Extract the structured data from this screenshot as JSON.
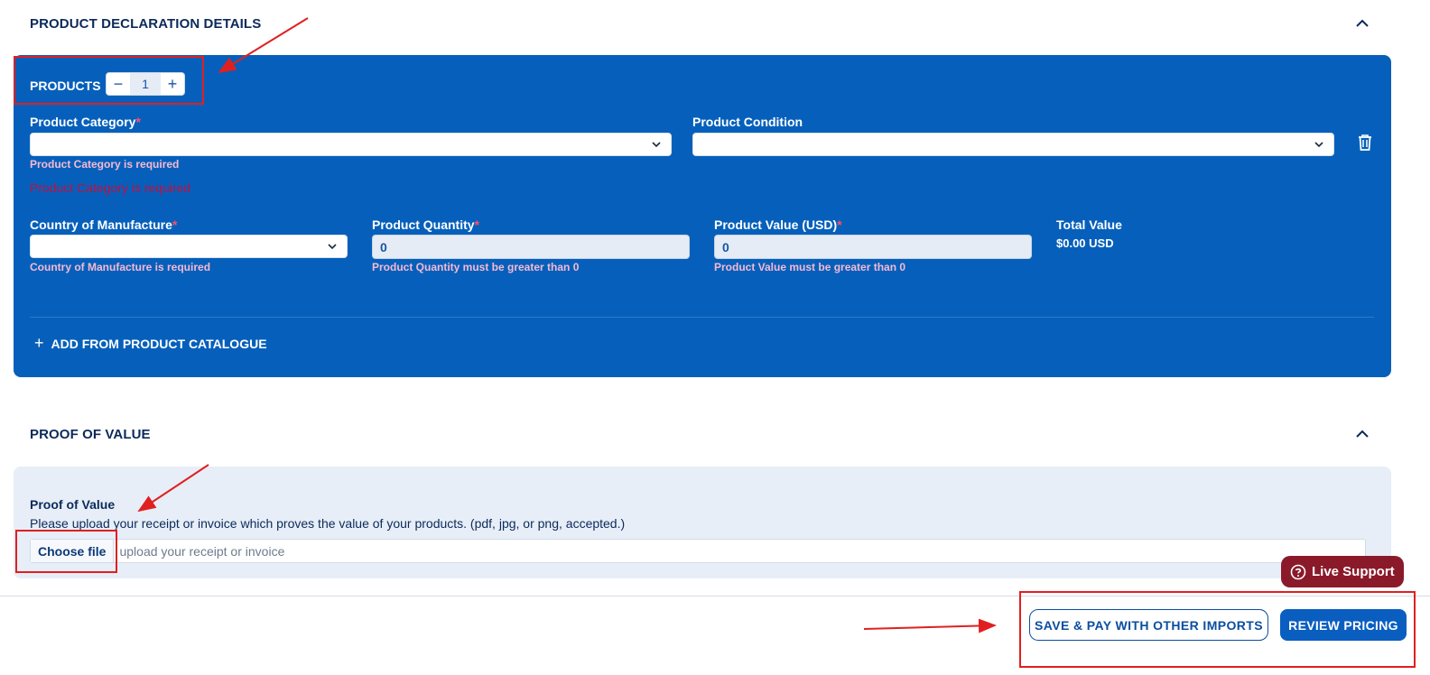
{
  "sections": {
    "product_declaration": {
      "title": "PRODUCT DECLARATION DETAILS"
    },
    "proof_of_value": {
      "title": "PROOF OF VALUE"
    }
  },
  "products": {
    "label": "PRODUCTS",
    "count": "1",
    "minus_symbol": "−",
    "plus_symbol": "+"
  },
  "fields": {
    "product_category": {
      "label": "Product Category",
      "required_mark": "*",
      "value": "",
      "error": "Product Category is required"
    },
    "product_condition": {
      "label": "Product Condition",
      "value": ""
    },
    "form_error": "Product Category is required",
    "country_of_manufacture": {
      "label": "Country of Manufacture",
      "required_mark": "*",
      "value": "",
      "error": "Country of Manufacture is required"
    },
    "product_quantity": {
      "label": "Product Quantity",
      "required_mark": "*",
      "value": "0",
      "error": "Product Quantity must be greater than 0"
    },
    "product_value": {
      "label": "Product Value (USD)",
      "required_mark": "*",
      "value": "0",
      "error": "Product Value must be greater than 0"
    },
    "total_value": {
      "label": "Total Value",
      "value": "$0.00 USD"
    }
  },
  "catalogue": {
    "plus": "+",
    "label": "ADD FROM PRODUCT CATALOGUE"
  },
  "proof": {
    "label": "Proof of Value",
    "description": "Please upload your receipt or invoice which proves the value of your products. (pdf, jpg, or png, accepted.)",
    "choose_file": "Choose file",
    "placeholder": "upload your receipt or invoice"
  },
  "live_support": {
    "label": "Live Support",
    "icon": "question-circle-icon"
  },
  "footer": {
    "save_pay_label": "SAVE & PAY WITH OTHER IMPORTS",
    "review_pricing_label": "REVIEW PRICING"
  },
  "colors": {
    "panel_blue": "#0660bb",
    "navy_text": "#0b2a5a",
    "error_pink": "#f7b9d2",
    "annotation_red": "#e02020",
    "live_support_bg": "#8a1a2a"
  }
}
